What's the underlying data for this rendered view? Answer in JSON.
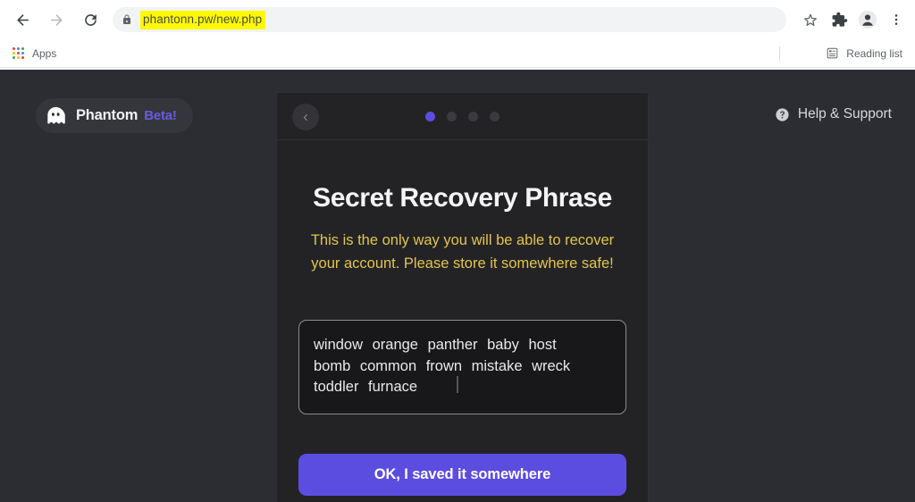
{
  "browser": {
    "back_label": "Back",
    "forward_label": "Forward",
    "reload_label": "Reload",
    "url": "phantonn.pw/new.php",
    "url_highlighted": true,
    "lock_icon": "lock-icon",
    "bookmark_icon": "star-icon",
    "extensions_icon": "puzzle-piece-icon",
    "profile_icon": "profile-avatar-icon",
    "menu_icon": "three-dot-menu-icon",
    "bookmarks": {
      "apps_label": "Apps",
      "apps_icon": "apps-grid-icon",
      "reading_list_label": "Reading list",
      "reading_list_icon": "reading-list-icon"
    }
  },
  "page": {
    "background_color": "#2b2d33",
    "brand": {
      "icon": "phantom-ghost-icon",
      "name": "Phantom",
      "beta_label": "Beta!",
      "beta_color": "#6a5ae0"
    },
    "help": {
      "icon": "question-mark-circle-icon",
      "label": "Help & Support"
    }
  },
  "modal": {
    "background_color": "#232326",
    "header": {
      "back_icon": "chevron-left-icon",
      "steps_total": 4,
      "active_step": 1
    },
    "title": "Secret Recovery Phrase",
    "warning": "This is the only way you will be able to recover your account. Please store it somewhere safe!",
    "warning_color": "#e3c44c",
    "seed_phrase": {
      "words": [
        "window",
        "orange",
        "panther",
        "baby",
        "host",
        "bomb",
        "common",
        "frown",
        "mistake",
        "wreck",
        "toddler",
        "furnace"
      ],
      "lines": [
        "window  orange  panther  baby  host",
        "bomb  common  frown  mistake  wreck",
        "toddler  furnace"
      ]
    },
    "cta_label": "OK, I saved it somewhere",
    "cta_color": "#5b4de0"
  }
}
